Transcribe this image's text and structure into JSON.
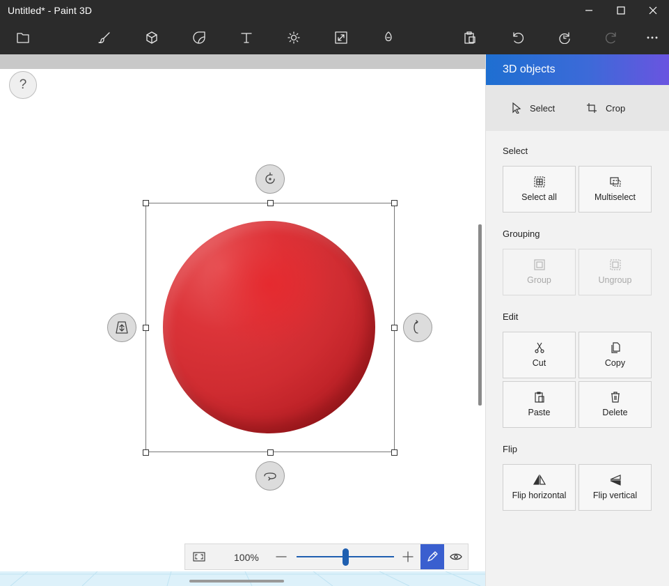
{
  "window": {
    "title": "Untitled* - Paint 3D",
    "minimize_icon": "minimize-icon",
    "maximize_icon": "maximize-icon",
    "close_icon": "close-icon"
  },
  "toolbar": {
    "items": [
      {
        "name": "menu",
        "icon": "folder-icon"
      },
      {
        "name": "brushes",
        "icon": "brush-icon"
      },
      {
        "name": "3d-shapes",
        "icon": "cube-icon"
      },
      {
        "name": "stickers",
        "icon": "sticker-icon"
      },
      {
        "name": "text",
        "icon": "text-icon"
      },
      {
        "name": "effects",
        "icon": "sun-icon"
      },
      {
        "name": "canvas",
        "icon": "resize-icon"
      },
      {
        "name": "3d-library",
        "icon": "library-icon"
      },
      {
        "name": "paste",
        "icon": "clipboard-icon"
      },
      {
        "name": "undo",
        "icon": "undo-icon"
      },
      {
        "name": "history",
        "icon": "history-icon"
      },
      {
        "name": "redo",
        "icon": "redo-icon",
        "disabled": true
      },
      {
        "name": "more",
        "icon": "more-icon"
      }
    ]
  },
  "canvas": {
    "help_label": "?",
    "object_color": "#d9262c"
  },
  "zoom": {
    "percent": "100%",
    "level": 0.5
  },
  "panel": {
    "title": "3D objects",
    "tools": {
      "select": "Select",
      "crop": "Crop"
    },
    "sections": {
      "select": {
        "title": "Select",
        "select_all": "Select all",
        "multiselect": "Multiselect"
      },
      "grouping": {
        "title": "Grouping",
        "group": "Group",
        "ungroup": "Ungroup"
      },
      "edit": {
        "title": "Edit",
        "cut": "Cut",
        "copy": "Copy",
        "paste": "Paste",
        "delete": "Delete"
      },
      "flip": {
        "title": "Flip",
        "flip_horizontal": "Flip horizontal",
        "flip_vertical": "Flip vertical"
      }
    }
  },
  "colors": {
    "accent": "#3a5fcf",
    "header_start": "#1e6fd1",
    "header_end": "#6a54e0"
  }
}
